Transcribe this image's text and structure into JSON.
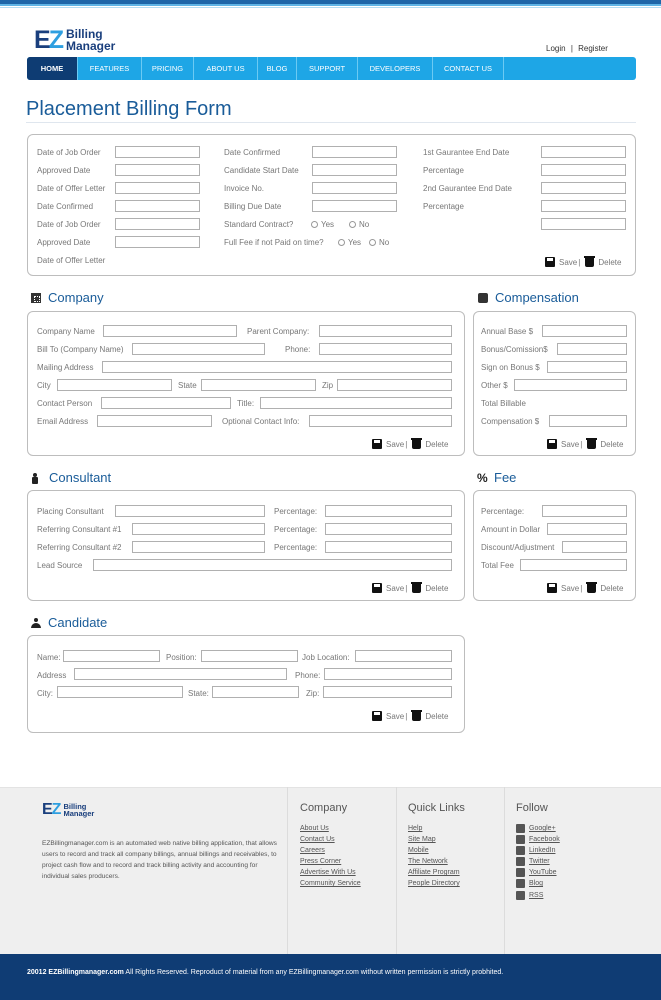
{
  "brand": {
    "logo_mark_e": "E",
    "logo_mark_z": "Z",
    "line1": "Billing",
    "line2": "Manager"
  },
  "auth": {
    "login": "Login",
    "sep": "|",
    "register": "Register"
  },
  "nav": [
    "HOME",
    "FEATURES",
    "PRICING",
    "ABOUT US",
    "BLOG",
    "SUPPORT",
    "DEVELOPERS",
    "CONTACT US"
  ],
  "page_title": "Placement Billing Form",
  "placement": {
    "col1": [
      "Date of Job Order",
      "Approved Date",
      "Date of Offer Letter",
      "Date Confirmed",
      "Date of Job Order",
      "Approved Date",
      "Date of Offer Letter"
    ],
    "col2": [
      "Date Confirmed",
      "Candidate Start Date",
      "Invoice No.",
      "Billing Due Date",
      "Standard Contract?",
      "Full Fee if not Paid on time?"
    ],
    "col3": [
      "1st Gaurantee End Date",
      "Percentage",
      "2nd Gaurantee End Date",
      "Percentage"
    ],
    "yes": "Yes",
    "no": "No"
  },
  "actions": {
    "save": "Save",
    "sep": "|",
    "delete": "Delete"
  },
  "company": {
    "title": "Company",
    "company_name": "Company Name",
    "parent_company": "Parent Company:",
    "bill_to": "Bill To (Company Name)",
    "phone": "Phone:",
    "mailing": "Mailing Address",
    "city": "City",
    "state": "State",
    "zip": "Zip",
    "contact": "Contact Person",
    "title_lbl": "Title:",
    "email": "Email Address",
    "optional": "Optional Contact Info:"
  },
  "compensation": {
    "title": "Compensation",
    "annual": "Annual Base $",
    "bonus": "Bonus/Comission$",
    "sign": "Sign on Bonus $",
    "other": "Other $",
    "total1": "Total Billable",
    "total2": "Compensation $"
  },
  "consultant": {
    "title": "Consultant",
    "placing": "Placing Consultant",
    "ref1": "Referring Consultant #1",
    "ref2": "Referring Consultant #2",
    "percentage": "Percentage:",
    "lead": "Lead Source"
  },
  "fee": {
    "title": "Fee",
    "percentage": "Percentage:",
    "amount": "Amount in Dollar",
    "discount": "Discount/Adjustment",
    "total": "Total Fee"
  },
  "candidate": {
    "title": "Candidate",
    "name": "Name:",
    "position": "Position:",
    "location": "Job Location:",
    "address": "Address",
    "phone": "Phone:",
    "city": "City:",
    "state": "State:",
    "zip": "Zip:"
  },
  "footer": {
    "description": "EZBillingmanager.com is an automated web native billing application, that allows users to record and track all company billings, annual billings and receivables, to project cash flow and to record and track billing activity and accounting for individual sales producers.",
    "company_title": "Company",
    "company_links": [
      "About Us",
      "Contact Us",
      "Careers",
      "Press Corner",
      "Advertise With Us",
      "Community Service"
    ],
    "quick_title": "Quick Links",
    "quick_links": [
      "Help",
      "Site Map",
      "Mobile",
      "The Network",
      "Affiliate Program",
      "People Directory"
    ],
    "follow_title": "Follow",
    "follow_links": [
      "Google+",
      "Facebook",
      "LinkedIn",
      "Twitter",
      "YouTube",
      "Blog",
      "RSS"
    ]
  },
  "copyright": {
    "bold": "20012 EZBillingmanager.com",
    "rest": " All Rights Reserved. Reproduct of material from any EZBillingmanager.com without written permission is strictly probhited."
  }
}
